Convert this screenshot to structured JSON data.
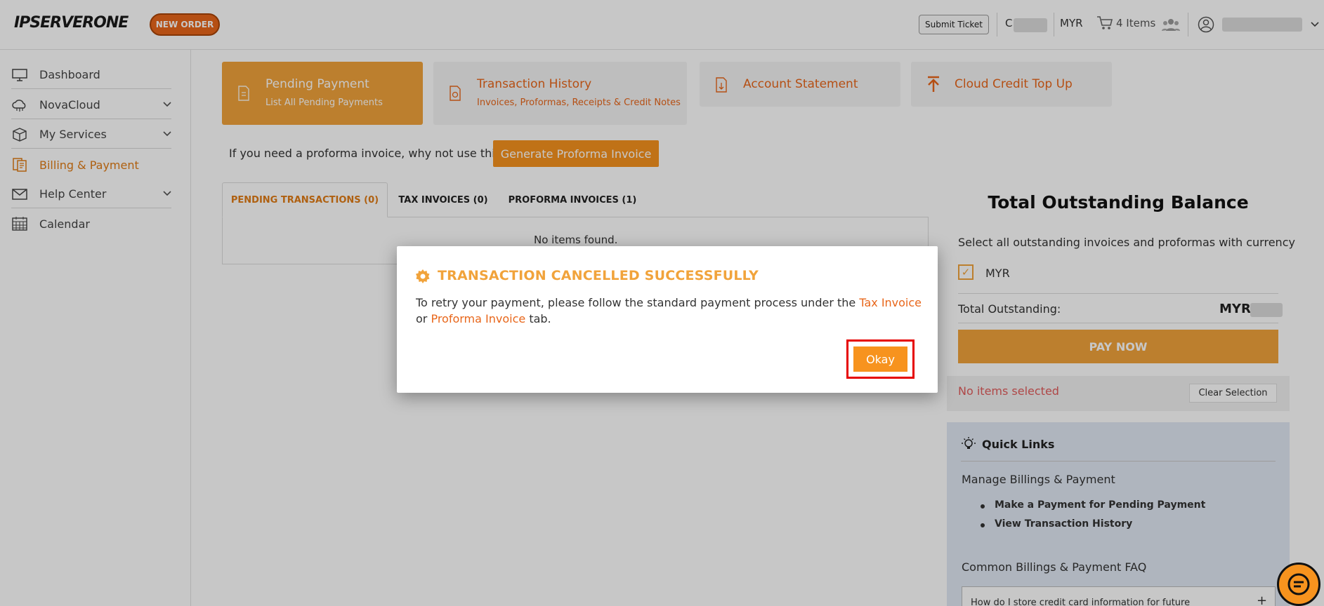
{
  "header": {
    "logo": "IPSERVERONE",
    "new_order": "NEW ORDER",
    "submit_ticket": "Submit Ticket",
    "account_initial": "C",
    "currency": "MYR",
    "cart_label": "4 Items"
  },
  "sidebar": {
    "items": [
      {
        "label": "Dashboard",
        "icon": "monitor-icon"
      },
      {
        "label": "NovaCloud",
        "icon": "cloud-icon"
      },
      {
        "label": "My Services",
        "icon": "box-icon"
      },
      {
        "label": "Billing & Payment",
        "icon": "billing-icon"
      },
      {
        "label": "Help Center",
        "icon": "mail-icon"
      },
      {
        "label": "Calendar",
        "icon": "calendar-icon"
      }
    ]
  },
  "tiles": [
    {
      "title": "Pending Payment",
      "subtitle": "List All Pending Payments"
    },
    {
      "title": "Transaction History",
      "subtitle": "Invoices, Proformas, Receipts & Credit Notes"
    },
    {
      "title": "Account Statement",
      "subtitle": ""
    },
    {
      "title": "Cloud Credit Top Up",
      "subtitle": ""
    }
  ],
  "proforma": {
    "text": "If you need a proforma invoice, why not use this?",
    "button": "Generate Proforma Invoice"
  },
  "tabs": [
    {
      "label": "PENDING TRANSACTIONS (0)"
    },
    {
      "label": "TAX INVOICES (0)"
    },
    {
      "label": "PROFORMA INVOICES (1)"
    }
  ],
  "tab_content": {
    "empty": "No items found."
  },
  "outstanding": {
    "title": "Total Outstanding Balance",
    "select_text": "Select all outstanding invoices and proformas with currency",
    "currency_option": "MYR",
    "total_label": "Total Outstanding:",
    "total_currency": "MYR",
    "pay_now": "PAY NOW",
    "no_items": "No items selected",
    "clear": "Clear Selection"
  },
  "quick_links": {
    "title": "Quick Links",
    "section1": "Manage Billings & Payment",
    "links": [
      "Make a Payment for Pending Payment",
      "View Transaction History"
    ],
    "section2": "Common Billings & Payment FAQ",
    "faq1": "How do I store credit card information for future"
  },
  "modal": {
    "title": "TRANSACTION CANCELLED SUCCESSFULLY",
    "body_1": "To retry your payment, please follow the standard payment process under the ",
    "link_1": "Tax Invoice",
    "body_2": " or ",
    "link_2": "Proforma Invoice",
    "body_3": " tab.",
    "okay": "Okay"
  },
  "colors": {
    "accent": "#f1a33b",
    "brand_orange": "#e8661a",
    "highlight": "#e60000"
  }
}
